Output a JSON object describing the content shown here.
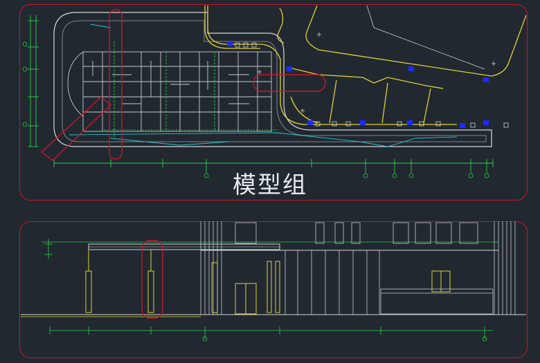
{
  "label": {
    "text": "模型组"
  },
  "colors": {
    "background": "#212830",
    "highlight": "#c8182b",
    "wall": "#d7d7d7",
    "green": "#2fd04a",
    "yellow": "#e0d23a",
    "cyan": "#2ec4cf",
    "blue": "#1e2bff",
    "white": "#e6e9ee"
  }
}
